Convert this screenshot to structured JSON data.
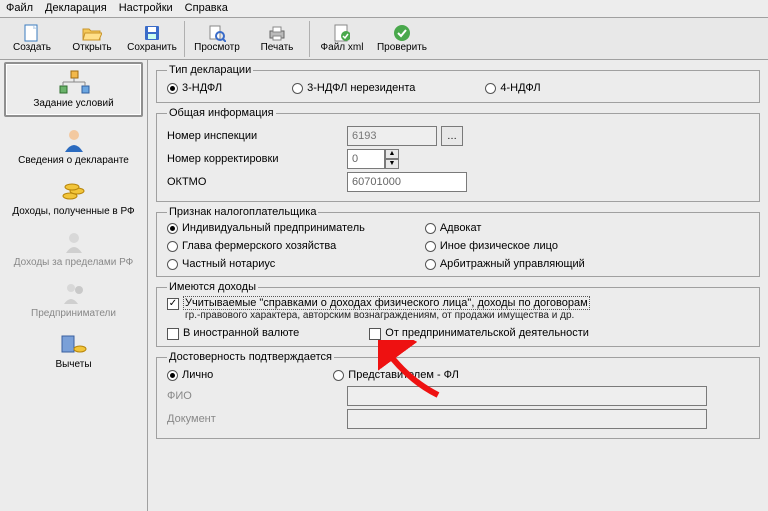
{
  "menu": {
    "file": "Файл",
    "declaration": "Декларация",
    "settings": "Настройки",
    "help": "Справка"
  },
  "toolbar": {
    "create": "Создать",
    "open": "Открыть",
    "save": "Сохранить",
    "preview": "Просмотр",
    "print": "Печать",
    "filexml": "Файл xml",
    "check": "Проверить"
  },
  "sidebar": {
    "items": [
      {
        "label": "Задание условий"
      },
      {
        "label": "Сведения о декларанте"
      },
      {
        "label": "Доходы, полученные в РФ"
      },
      {
        "label": "Доходы за пределами РФ"
      },
      {
        "label": "Предприниматели"
      },
      {
        "label": "Вычеты"
      }
    ]
  },
  "groups": {
    "decl_type": {
      "legend": "Тип декларации",
      "r1": "3-НДФЛ",
      "r2": "3-НДФЛ нерезидента",
      "r3": "4-НДФЛ"
    },
    "general": {
      "legend": "Общая информация",
      "inspection_label": "Номер инспекции",
      "inspection_value": "6193",
      "correction_label": "Номер корректировки",
      "correction_value": "0",
      "oktmo_label": "ОКТМО",
      "oktmo_value": "60701000"
    },
    "taxpayer": {
      "legend": "Признак налогоплательщика",
      "r1": "Индивидуальный предприниматель",
      "r2": "Глава фермерского хозяйства",
      "r3": "Частный нотариус",
      "r4": "Адвокат",
      "r5": "Иное физическое лицо",
      "r6": "Арбитражный управляющий"
    },
    "income": {
      "legend": "Имеются доходы",
      "c1": "Учитываемые \"справками о доходах физического лица\", доходы по договорам",
      "c1_sub": "гр.-правового характера, авторским вознаграждениям, от продажи имущества и др.",
      "c2": "В иностранной валюте",
      "c3": "От предпринимательской деятельности"
    },
    "confirm": {
      "legend": "Достоверность подтверждается",
      "r1": "Лично",
      "r2": "Представителем - ФЛ",
      "fio_label": "ФИО",
      "doc_label": "Документ"
    }
  }
}
